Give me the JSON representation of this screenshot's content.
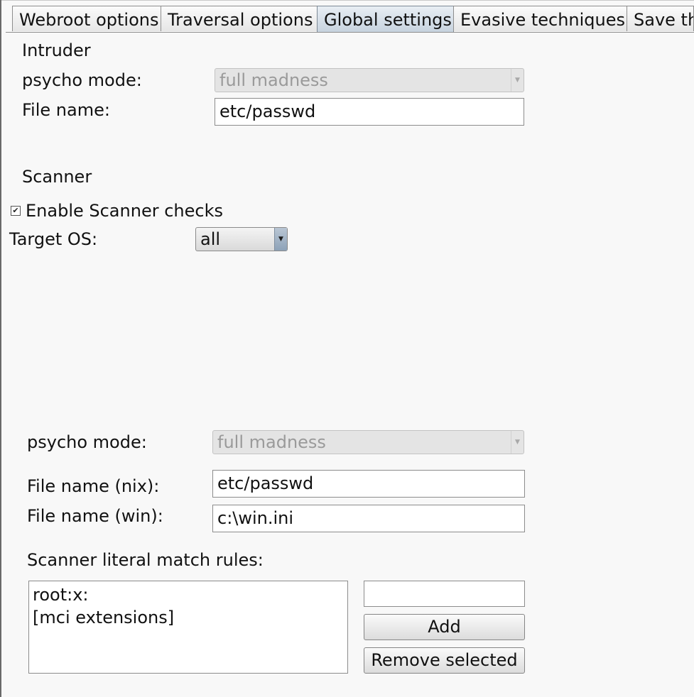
{
  "tabs": [
    {
      "label": "Webroot options"
    },
    {
      "label": "Traversal options"
    },
    {
      "label": "Global settings"
    },
    {
      "label": "Evasive techniques"
    },
    {
      "label": "Save th"
    }
  ],
  "intruder": {
    "heading": "Intruder",
    "psycho_label": "psycho mode:",
    "psycho_value": "full madness",
    "filename_label": "File name:",
    "filename_value": "etc/passwd"
  },
  "scanner": {
    "heading": "Scanner",
    "enable_label": "Enable Scanner checks",
    "enable_checked": true,
    "target_os_label": "Target OS:",
    "target_os_value": "all",
    "psycho_label": "psycho mode:",
    "psycho_value": "full madness",
    "nix_label": "File name (nix):",
    "nix_value": "etc/passwd",
    "win_label": "File name (win):",
    "win_value": "c:\\win.ini",
    "rules_label": "Scanner literal match rules:",
    "rules": [
      "root:x:",
      "[mci extensions]"
    ],
    "new_rule_value": "",
    "add_label": "Add",
    "remove_label": "Remove selected"
  }
}
